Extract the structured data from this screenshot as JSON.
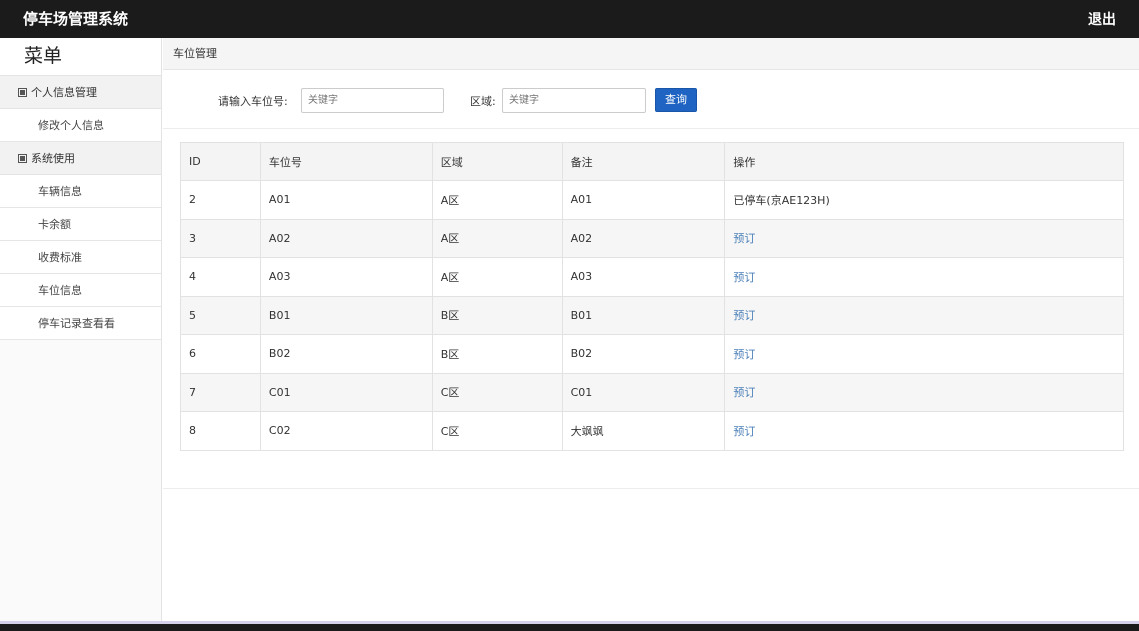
{
  "header": {
    "title": "停车场管理系统",
    "logout": "退出"
  },
  "sidebar": {
    "title": "菜单",
    "groups": [
      {
        "label": "个人信息管理",
        "items": [
          "修改个人信息"
        ]
      },
      {
        "label": "系统使用",
        "items": [
          "车辆信息",
          "卡余额",
          "收费标准",
          "车位信息",
          "停车记录查看看"
        ]
      }
    ]
  },
  "breadcrumb": "车位管理",
  "search": {
    "label_spot": "请输入车位号:",
    "placeholder_spot": "关键字",
    "label_area": "区域:",
    "placeholder_area": "关键字",
    "button": "查询"
  },
  "table": {
    "columns": [
      "ID",
      "车位号",
      "区域",
      "备注",
      "操作"
    ],
    "rows": [
      [
        "2",
        "A01",
        "A区",
        "A01",
        "已停车(京AE123H)"
      ],
      [
        "3",
        "A02",
        "A区",
        "A02",
        "预订"
      ],
      [
        "4",
        "A03",
        "A区",
        "A03",
        "预订"
      ],
      [
        "5",
        "B01",
        "B区",
        "B01",
        "预订"
      ],
      [
        "6",
        "B02",
        "B区",
        "B02",
        "预订"
      ],
      [
        "7",
        "C01",
        "C区",
        "C01",
        "预订"
      ],
      [
        "8",
        "C02",
        "C区",
        "大飒飒",
        "预订"
      ]
    ]
  }
}
